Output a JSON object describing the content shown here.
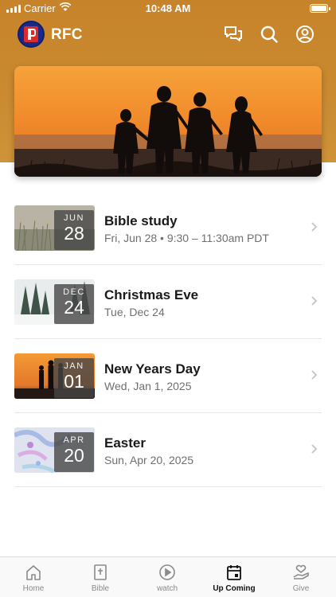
{
  "status_bar": {
    "carrier": "Carrier",
    "time": "10:48 AM"
  },
  "header": {
    "title": "RFC",
    "icons": [
      "chat-icon",
      "search-icon",
      "profile-icon"
    ]
  },
  "events": [
    {
      "month": "JUN",
      "day": "28",
      "title": "Bible study",
      "subtitle": "Fri, Jun 28 • 9:30 – 11:30am PDT",
      "thumbnail": "grass-field"
    },
    {
      "month": "DEC",
      "day": "24",
      "title": "Christmas Eve",
      "subtitle": "Tue, Dec 24",
      "thumbnail": "snowy-forest"
    },
    {
      "month": "JAN",
      "day": "01",
      "title": "New Years Day",
      "subtitle": "Wed, Jan 1, 2025",
      "thumbnail": "sunset-family"
    },
    {
      "month": "APR",
      "day": "20",
      "title": "Easter",
      "subtitle": "Sun, Apr 20, 2025",
      "thumbnail": "pastel-paint"
    }
  ],
  "tabs": [
    {
      "label": "Home",
      "icon": "home-icon",
      "active": false
    },
    {
      "label": "Bible",
      "icon": "bible-icon",
      "active": false
    },
    {
      "label": "watch",
      "icon": "play-icon",
      "active": false
    },
    {
      "label": "Up Coming",
      "icon": "calendar-icon",
      "active": true
    },
    {
      "label": "Give",
      "icon": "give-icon",
      "active": false
    }
  ],
  "colors": {
    "header_orange": "#c98a30",
    "date_overlay": "#464646",
    "active_tab": "#111111",
    "inactive_tab": "#8a8a8a"
  }
}
